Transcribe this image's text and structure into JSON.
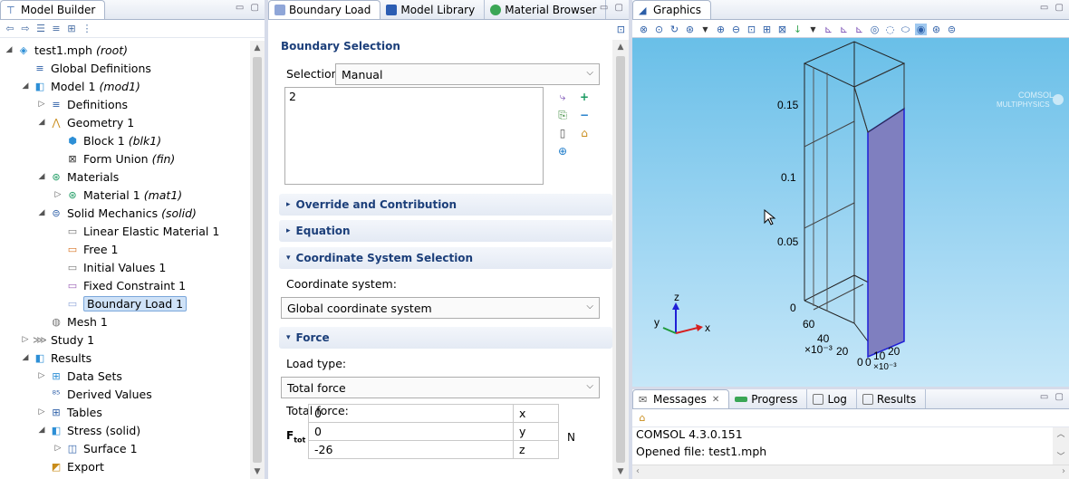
{
  "model_builder": {
    "tab_label": "Model Builder",
    "tree": [
      {
        "label": "test1.mph",
        "suffix": "(root)",
        "level": 0,
        "twisty": "open",
        "icon": "file-icon"
      },
      {
        "label": "Global Definitions",
        "suffix": "",
        "level": 1,
        "twisty": "",
        "icon": "global-definitions-icon"
      },
      {
        "label": "Model 1",
        "suffix": "(mod1)",
        "level": 1,
        "twisty": "open",
        "icon": "model-icon"
      },
      {
        "label": "Definitions",
        "suffix": "",
        "level": 2,
        "twisty": "closed",
        "icon": "definitions-icon"
      },
      {
        "label": "Geometry 1",
        "suffix": "",
        "level": 2,
        "twisty": "open",
        "icon": "geometry-icon"
      },
      {
        "label": "Block 1",
        "suffix": "(blk1)",
        "level": 3,
        "twisty": "",
        "icon": "block-icon"
      },
      {
        "label": "Form Union",
        "suffix": "(fin)",
        "level": 3,
        "twisty": "",
        "icon": "form-union-icon"
      },
      {
        "label": "Materials",
        "suffix": "",
        "level": 2,
        "twisty": "open",
        "icon": "materials-icon"
      },
      {
        "label": "Material 1",
        "suffix": "(mat1)",
        "level": 3,
        "twisty": "closed",
        "icon": "material-icon"
      },
      {
        "label": "Solid Mechanics",
        "suffix": "(solid)",
        "level": 2,
        "twisty": "open",
        "icon": "solid-mechanics-icon"
      },
      {
        "label": "Linear Elastic Material 1",
        "suffix": "",
        "level": 3,
        "twisty": "",
        "icon": "linear-elastic-icon"
      },
      {
        "label": "Free 1",
        "suffix": "",
        "level": 3,
        "twisty": "",
        "icon": "free-icon"
      },
      {
        "label": "Initial Values 1",
        "suffix": "",
        "level": 3,
        "twisty": "",
        "icon": "initial-values-icon"
      },
      {
        "label": "Fixed Constraint 1",
        "suffix": "",
        "level": 3,
        "twisty": "",
        "icon": "fixed-constraint-icon"
      },
      {
        "label": "Boundary Load 1",
        "suffix": "",
        "level": 3,
        "twisty": "",
        "icon": "boundary-load-icon",
        "selected": true
      },
      {
        "label": "Mesh 1",
        "suffix": "",
        "level": 2,
        "twisty": "",
        "icon": "mesh-icon"
      },
      {
        "label": "Study 1",
        "suffix": "",
        "level": 1,
        "twisty": "closed",
        "icon": "study-icon"
      },
      {
        "label": "Results",
        "suffix": "",
        "level": 1,
        "twisty": "open",
        "icon": "results-icon"
      },
      {
        "label": "Data Sets",
        "suffix": "",
        "level": 2,
        "twisty": "closed",
        "icon": "data-sets-icon"
      },
      {
        "label": "Derived Values",
        "suffix": "",
        "level": 2,
        "twisty": "",
        "icon": "derived-values-icon"
      },
      {
        "label": "Tables",
        "suffix": "",
        "level": 2,
        "twisty": "closed",
        "icon": "tables-icon"
      },
      {
        "label": "Stress (solid)",
        "suffix": "",
        "level": 2,
        "twisty": "open",
        "icon": "stress-plot-icon"
      },
      {
        "label": "Surface 1",
        "suffix": "",
        "level": 3,
        "twisty": "closed",
        "icon": "surface-icon"
      },
      {
        "label": "Export",
        "suffix": "",
        "level": 2,
        "twisty": "",
        "icon": "export-icon"
      }
    ]
  },
  "settings": {
    "tabs": [
      "Boundary Load",
      "Model Library",
      "Material Browser"
    ],
    "boundary_selection_title": "Boundary Selection",
    "selection_label": "Selection:",
    "selection_value": "Manual",
    "selected_entities": "2",
    "sections": {
      "override": "Override and Contribution",
      "equation": "Equation",
      "coord_sel": "Coordinate System Selection",
      "force": "Force"
    },
    "coord_label": "Coordinate system:",
    "coord_value": "Global coordinate system",
    "load_type_label": "Load type:",
    "load_type_value": "Total force",
    "total_force_label": "Total force:",
    "force_symbol": "F",
    "force_subscript": "tot",
    "force_unit": "N",
    "force_components": [
      {
        "value": "0",
        "axis": "x"
      },
      {
        "value": "0",
        "axis": "y"
      },
      {
        "value": "-26",
        "axis": "z"
      }
    ]
  },
  "graphics": {
    "tab_label": "Graphics",
    "watermark_1": "COMSOL",
    "watermark_2": "MULTIPHYSICS",
    "z_ticks": [
      "0.15",
      "0.1",
      "0.05",
      "0"
    ],
    "y_ticks": [
      "60",
      "40",
      "20"
    ],
    "y_scale": "×10⁻³",
    "x_ticks": [
      "0",
      "0",
      "10",
      "20"
    ],
    "x_scale": "×10⁻³",
    "axis_x": "x",
    "axis_y": "y",
    "axis_z": "z",
    "highlight_color": "#7f7fbf"
  },
  "messages": {
    "tabs": [
      "Messages",
      "Progress",
      "Log",
      "Results"
    ],
    "lines": [
      "COMSOL 4.3.0.151",
      "Opened file: test1.mph"
    ]
  }
}
